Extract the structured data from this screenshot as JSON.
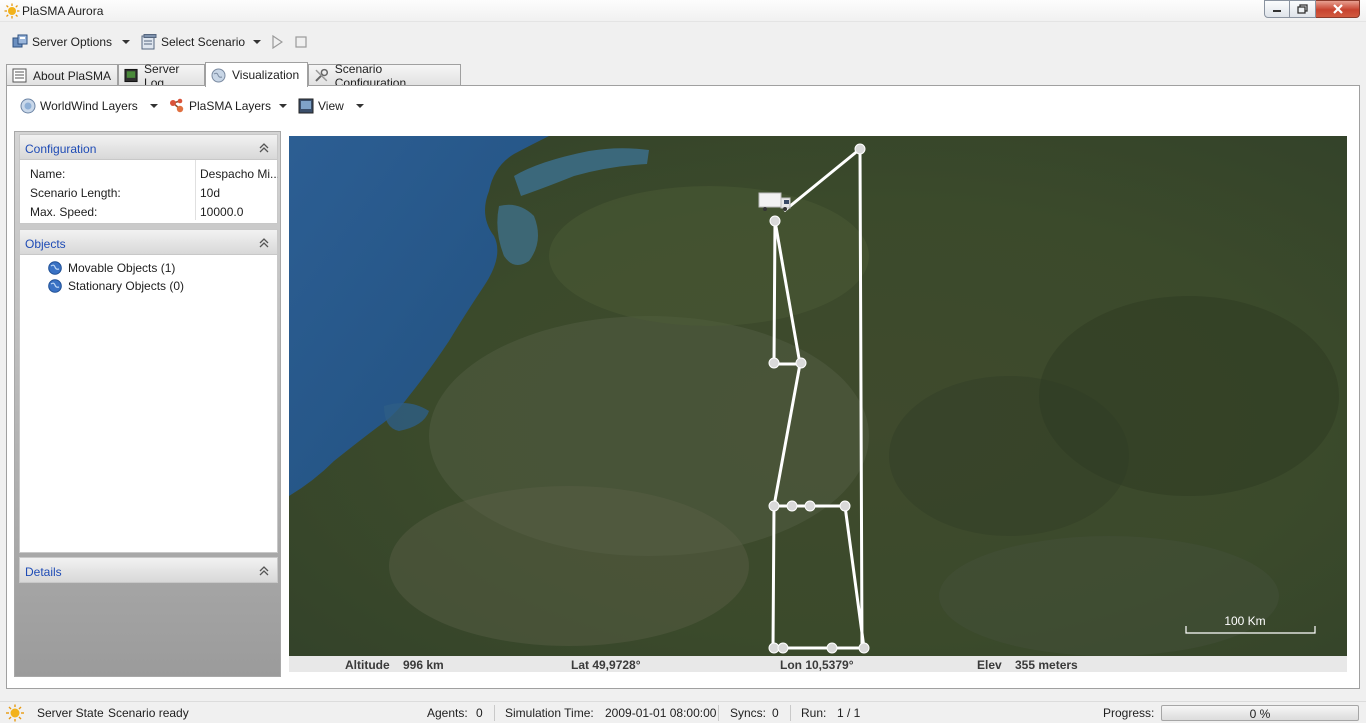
{
  "window": {
    "title": "PlaSMA Aurora",
    "icon": "sun-icon"
  },
  "toolbar": {
    "server_options": "Server Options",
    "select_scenario": "Select Scenario",
    "play_icon": "play-icon",
    "stop_icon": "stop-icon"
  },
  "tabs": [
    {
      "label": "About PlaSMA",
      "icon": "document-icon"
    },
    {
      "label": "Server Log",
      "icon": "terminal-icon"
    },
    {
      "label": "Visualization",
      "icon": "globe-icon",
      "active": true
    },
    {
      "label": "Scenario Configuration",
      "icon": "tools-icon"
    }
  ],
  "viz_toolbar": {
    "worldwind_layers": "WorldWind Layers",
    "plasma_layers": "PlaSMA Layers",
    "view": "View"
  },
  "configuration": {
    "title": "Configuration",
    "rows": [
      {
        "key": "Name:",
        "value": "Despacho Mi..."
      },
      {
        "key": "Scenario Length:",
        "value": "10d"
      },
      {
        "key": "Max. Speed:",
        "value": "10000.0"
      }
    ]
  },
  "objects": {
    "title": "Objects",
    "items": [
      {
        "label": "Movable Objects (1)"
      },
      {
        "label": "Stationary Objects (0)"
      }
    ]
  },
  "details": {
    "title": "Details"
  },
  "map": {
    "scale_label": "100 Km",
    "altitude_label": "Altitude",
    "altitude_value": "996 km",
    "lat": "Lat 49,9728°",
    "lon": "Lon 10,5379°",
    "elev_label": "Elev",
    "elev_value": "355 meters"
  },
  "status": {
    "server_state_label": "Server State",
    "server_state_value": "Scenario ready",
    "agents_label": "Agents:",
    "agents_value": "0",
    "sim_time_label": "Simulation Time:",
    "sim_time_value": "2009-01-01 08:00:00",
    "syncs_label": "Syncs:",
    "syncs_value": "0",
    "run_label": "Run:",
    "run_value": "1 / 1",
    "progress_label": "Progress:",
    "progress_value": "0 %",
    "progress_fraction": 0.0
  },
  "colors": {
    "accent_link": "#1e4bb5",
    "sea": "#2b5a8a",
    "land": "#3d4a2c",
    "route": "#ffffff"
  }
}
